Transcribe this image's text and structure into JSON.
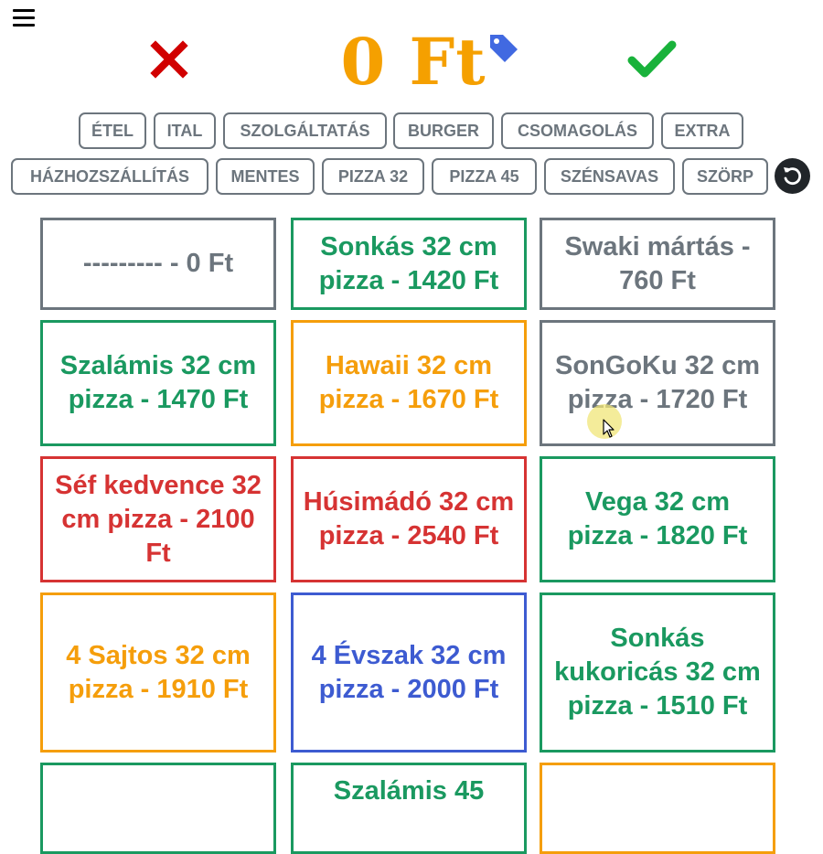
{
  "colors": {
    "accent_orange": "#f5a000",
    "cancel_red": "#d10000",
    "confirm_green": "#19b23b",
    "tag_blue": "#4169e1",
    "grey": "#6c757d",
    "green": "#1a9960",
    "orange": "#f59e0b",
    "red": "#d63333",
    "blue": "#3d5bd1"
  },
  "header": {
    "menu_icon": "hamburger-icon",
    "cancel_icon": "x-icon",
    "total": "0 Ft",
    "tag_icon": "price-tag-icon",
    "confirm_icon": "checkmark-icon",
    "reset_icon": "undo-icon"
  },
  "categories": {
    "row1": [
      "ÉTEL",
      "ITAL",
      "SZOLGÁLTATÁS",
      "BURGER",
      "CSOMAGOLÁS",
      "EXTRA"
    ],
    "row2": [
      "HÁZHOZSZÁLLÍTÁS",
      "MENTES",
      "PIZZA 32",
      "PIZZA 45",
      "SZÉNSAVAS",
      "SZÖRP"
    ]
  },
  "products": [
    {
      "label": "--------- - 0 Ft",
      "color": "#6c757d"
    },
    {
      "label": "Sonkás 32 cm pizza - 1420 Ft",
      "color": "#1a9960"
    },
    {
      "label": "Swaki mártás - 760 Ft",
      "color": "#6c757d"
    },
    {
      "label": "Szalámis 32 cm pizza - 1470 Ft",
      "color": "#1a9960"
    },
    {
      "label": "Hawaii 32 cm pizza - 1670 Ft",
      "color": "#f59e0b"
    },
    {
      "label": "SonGoKu 32 cm pizza - 1720 Ft",
      "color": "#6c757d"
    },
    {
      "label": "Séf kedvence 32 cm pizza - 2100 Ft",
      "color": "#d63333"
    },
    {
      "label": "Húsimádó 32 cm pizza - 2540 Ft",
      "color": "#d63333"
    },
    {
      "label": "Vega 32 cm pizza - 1820 Ft",
      "color": "#1a9960"
    },
    {
      "label": "4 Sajtos 32 cm pizza - 1910 Ft",
      "color": "#f59e0b"
    },
    {
      "label": "4 Évszak 32 cm pizza - 2000 Ft",
      "color": "#3d5bd1"
    },
    {
      "label": "Sonkás kukoricás 32 cm pizza - 1510 Ft",
      "color": "#1a9960"
    },
    {
      "label": "",
      "color": "#1a9960"
    },
    {
      "label": "Szalámis 45",
      "color": "#1a9960"
    },
    {
      "label": "",
      "color": "#f59e0b"
    }
  ]
}
